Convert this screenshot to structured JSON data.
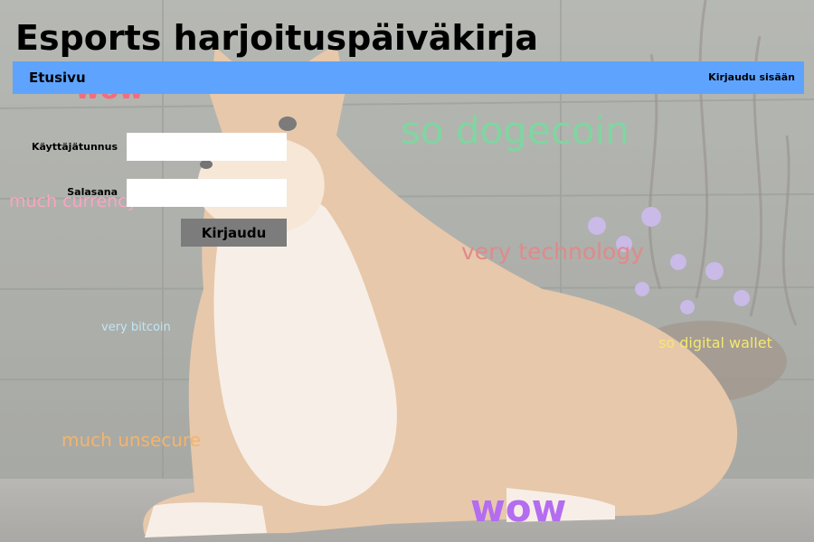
{
  "app": {
    "title": "Esports harjoituspäiväkirja"
  },
  "nav": {
    "home_label": "Etusivu",
    "login_label": "Kirjaudu sisään"
  },
  "login_form": {
    "username_label": "Käyttäjätunnus",
    "username_value": "",
    "password_label": "Salasana",
    "password_value": "",
    "submit_label": "Kirjaudu"
  },
  "background": {
    "meme_words": [
      {
        "text": "wow",
        "color": "#f26d7d"
      },
      {
        "text": "so dogecoin",
        "color": "#7fd6a0"
      },
      {
        "text": "much currency",
        "color": "#f7a6c0"
      },
      {
        "text": "very technology",
        "color": "#e08a8a"
      },
      {
        "text": "very bitcoin",
        "color": "#bfe6f7"
      },
      {
        "text": "so digital wallet",
        "color": "#f5e86e"
      },
      {
        "text": "much unsecure",
        "color": "#f6b36b"
      },
      {
        "text": "wow",
        "color": "#b46cf0"
      }
    ]
  },
  "colors": {
    "nav_background": "#5ea4ff",
    "button_background": "#7c7c7c",
    "input_background": "#ffffff"
  }
}
